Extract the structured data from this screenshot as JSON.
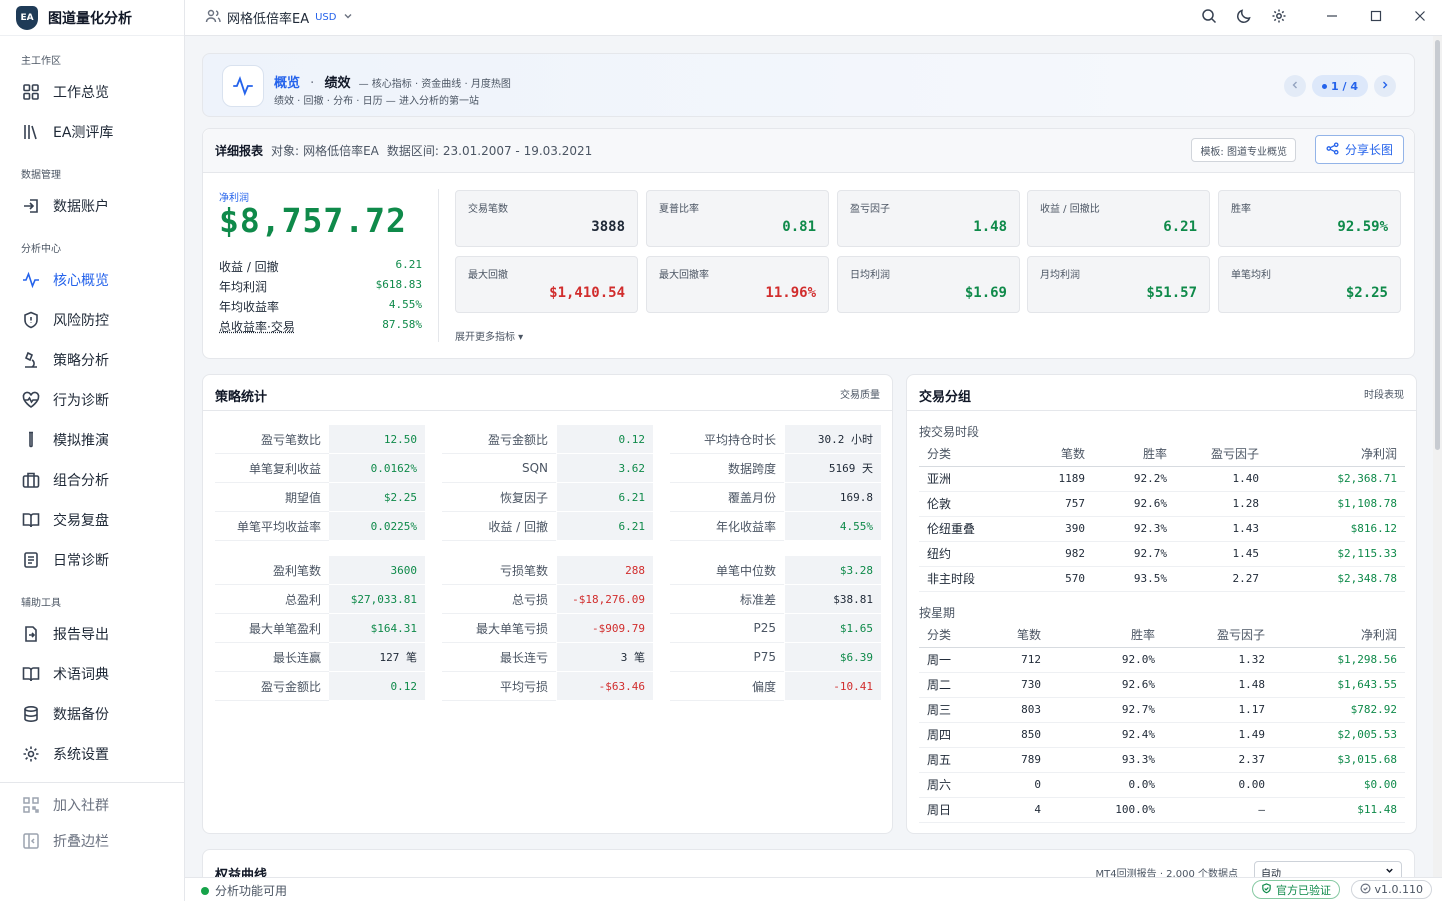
{
  "app": {
    "title": "图道量化分析",
    "logo_text": "EA"
  },
  "topbar": {
    "account": "网格低倍率EA",
    "currency": "USD"
  },
  "sidebar": {
    "sections": [
      {
        "label": "主工作区",
        "items": [
          {
            "label": "工作总览",
            "icon": "grid-icon"
          },
          {
            "label": "EA测评库",
            "icon": "library-icon"
          }
        ]
      },
      {
        "label": "数据管理",
        "items": [
          {
            "label": "数据账户",
            "icon": "login-icon"
          }
        ]
      },
      {
        "label": "分析中心",
        "items": [
          {
            "label": "核心概览",
            "icon": "activity-icon",
            "active": true
          },
          {
            "label": "风险防控",
            "icon": "shield-icon"
          },
          {
            "label": "策略分析",
            "icon": "microscope-icon"
          },
          {
            "label": "行为诊断",
            "icon": "heart-pulse-icon"
          },
          {
            "label": "模拟推演",
            "icon": "test-tube-icon"
          },
          {
            "label": "组合分析",
            "icon": "briefcase-icon"
          },
          {
            "label": "交易复盘",
            "icon": "book-open-icon"
          },
          {
            "label": "日常诊断",
            "icon": "clipboard-icon"
          }
        ]
      },
      {
        "label": "辅助工具",
        "items": [
          {
            "label": "报告导出",
            "icon": "file-export-icon"
          },
          {
            "label": "术语词典",
            "icon": "book-icon"
          },
          {
            "label": "数据备份",
            "icon": "database-icon"
          },
          {
            "label": "系统设置",
            "icon": "gear-icon"
          }
        ]
      }
    ],
    "footer": [
      {
        "label": "加入社群",
        "icon": "qr-code-icon"
      },
      {
        "label": "折叠边栏",
        "icon": "collapse-sidebar-icon"
      }
    ]
  },
  "banner": {
    "crumb": "概览",
    "dot": "·",
    "title": "绩效",
    "desc": "— 核心指标 · 资金曲线 · 月度热图",
    "sub": "绩效 · 回撤 · 分布 · 日历 — 进入分析的第一站",
    "page": "1 / 4"
  },
  "report": {
    "title": "详细报表",
    "object_label": "对象:",
    "object": "网格低倍率EA",
    "range_label": "数据区间:",
    "range": "23.01.2007 - 19.03.2021",
    "template_btn": "模板: 图道专业概览",
    "share_btn": "分享长图",
    "net_profit_label": "净利润",
    "net_profit": "$8,757.72",
    "summary": [
      {
        "label": "收益 / 回撤",
        "value": "6.21"
      },
      {
        "label": "年均利润",
        "value": "$618.83"
      },
      {
        "label": "年均收益率",
        "value": "4.55%"
      },
      {
        "label": "总收益率·交易",
        "value": "87.58%"
      }
    ],
    "kpis": [
      {
        "label": "交易笔数",
        "value": "3888",
        "tone": "neutral"
      },
      {
        "label": "夏普比率",
        "value": "0.81",
        "tone": "green"
      },
      {
        "label": "盈亏因子",
        "value": "1.48",
        "tone": "green"
      },
      {
        "label": "收益 / 回撤比",
        "value": "6.21",
        "tone": "green"
      },
      {
        "label": "胜率",
        "value": "92.59%",
        "tone": "green"
      },
      {
        "label": "最大回撤",
        "value": "$1,410.54",
        "tone": "red"
      },
      {
        "label": "最大回撤率",
        "value": "11.96%",
        "tone": "red"
      },
      {
        "label": "日均利润",
        "value": "$1.69",
        "tone": "green"
      },
      {
        "label": "月均利润",
        "value": "$51.57",
        "tone": "green"
      },
      {
        "label": "单笔均利",
        "value": "$2.25",
        "tone": "green"
      }
    ],
    "more": "展开更多指标 ▾"
  },
  "stats": {
    "title": "策略统计",
    "tag": "交易质量",
    "block1": [
      [
        {
          "label": "盈亏笔数比",
          "value": "12.50",
          "tone": "green"
        },
        {
          "label": "盈亏金额比",
          "value": "0.12",
          "tone": "green"
        },
        {
          "label": "平均持仓时长",
          "value": "30.2 小时",
          "tone": "neutral"
        }
      ],
      [
        {
          "label": "单笔复利收益",
          "value": "0.0162%",
          "tone": "green"
        },
        {
          "label": "SQN",
          "value": "3.62",
          "tone": "green"
        },
        {
          "label": "数据跨度",
          "value": "5169 天",
          "tone": "neutral"
        }
      ],
      [
        {
          "label": "期望值",
          "value": "$2.25",
          "tone": "green"
        },
        {
          "label": "恢复因子",
          "value": "6.21",
          "tone": "green"
        },
        {
          "label": "覆盖月份",
          "value": "169.8",
          "tone": "neutral"
        }
      ],
      [
        {
          "label": "单笔平均收益率",
          "value": "0.0225%",
          "tone": "green"
        },
        {
          "label": "收益 / 回撤",
          "value": "6.21",
          "tone": "green"
        },
        {
          "label": "年化收益率",
          "value": "4.55%",
          "tone": "green"
        }
      ]
    ],
    "block2": [
      [
        {
          "label": "盈利笔数",
          "value": "3600",
          "tone": "green"
        },
        {
          "label": "亏损笔数",
          "value": "288",
          "tone": "red"
        },
        {
          "label": "单笔中位数",
          "value": "$3.28",
          "tone": "green"
        }
      ],
      [
        {
          "label": "总盈利",
          "value": "$27,033.81",
          "tone": "green"
        },
        {
          "label": "总亏损",
          "value": "-$18,276.09",
          "tone": "red"
        },
        {
          "label": "标准差",
          "value": "$38.81",
          "tone": "neutral"
        }
      ],
      [
        {
          "label": "最大单笔盈利",
          "value": "$164.31",
          "tone": "green"
        },
        {
          "label": "最大单笔亏损",
          "value": "-$909.79",
          "tone": "red"
        },
        {
          "label": "P25",
          "value": "$1.65",
          "tone": "green"
        }
      ],
      [
        {
          "label": "最长连赢",
          "value": "127 笔",
          "tone": "neutral"
        },
        {
          "label": "最长连亏",
          "value": "3 笔",
          "tone": "neutral"
        },
        {
          "label": "P75",
          "value": "$6.39",
          "tone": "green"
        }
      ],
      [
        {
          "label": "盈亏金额比",
          "value": "0.12",
          "tone": "green"
        },
        {
          "label": "平均亏损",
          "value": "-$63.46",
          "tone": "red"
        },
        {
          "label": "偏度",
          "value": "-10.41",
          "tone": "red"
        }
      ]
    ]
  },
  "groups": {
    "title": "交易分组",
    "tag": "时段表现",
    "session_title": "按交易时段",
    "weekday_title": "按星期",
    "headers": [
      "分类",
      "笔数",
      "胜率",
      "盈亏因子",
      "净利润"
    ],
    "sessions": [
      [
        "亚洲",
        "1189",
        "92.2%",
        "1.40",
        "$2,368.71"
      ],
      [
        "伦敦",
        "757",
        "92.6%",
        "1.28",
        "$1,108.78"
      ],
      [
        "伦纽重叠",
        "390",
        "92.3%",
        "1.43",
        "$816.12"
      ],
      [
        "纽约",
        "982",
        "92.7%",
        "1.45",
        "$2,115.33"
      ],
      [
        "非主时段",
        "570",
        "93.5%",
        "2.27",
        "$2,348.78"
      ]
    ],
    "weekdays": [
      [
        "周一",
        "712",
        "92.0%",
        "1.32",
        "$1,298.56"
      ],
      [
        "周二",
        "730",
        "92.6%",
        "1.48",
        "$1,643.55"
      ],
      [
        "周三",
        "803",
        "92.7%",
        "1.17",
        "$782.92"
      ],
      [
        "周四",
        "850",
        "92.4%",
        "1.49",
        "$2,005.53"
      ],
      [
        "周五",
        "789",
        "93.3%",
        "2.37",
        "$3,015.68"
      ],
      [
        "周六",
        "0",
        "0.0%",
        "0.00",
        "$0.00"
      ],
      [
        "周日",
        "4",
        "100.0%",
        "–",
        "$11.48"
      ]
    ]
  },
  "equity": {
    "title": "权益曲线",
    "meta": "MT4回测报告 · 2,000 个数据点",
    "mode": "自动"
  },
  "status": {
    "text": "分析功能可用",
    "verified": "官方已验证",
    "version": "v1.0.110"
  },
  "colors": {
    "accent": "#2563eb",
    "positive": "#0f8a4a",
    "negative": "#d12d2d"
  }
}
